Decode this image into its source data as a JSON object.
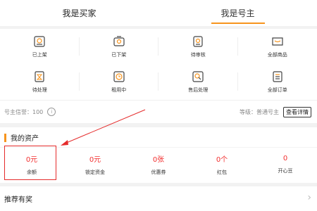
{
  "tabs": [
    {
      "label": "我是买家",
      "active": false
    },
    {
      "label": "我是号主",
      "active": true
    }
  ],
  "menu": [
    {
      "label": "已上架",
      "icon": "shelf-up-icon"
    },
    {
      "label": "已下架",
      "icon": "shelf-down-icon"
    },
    {
      "label": "待审核",
      "icon": "pending-review-icon"
    },
    {
      "label": "全部商品",
      "icon": "all-products-icon"
    },
    {
      "label": "待处理",
      "icon": "pending-icon"
    },
    {
      "label": "租用中",
      "icon": "renting-icon"
    },
    {
      "label": "售后处理",
      "icon": "after-sales-icon"
    },
    {
      "label": "全部订单",
      "icon": "all-orders-icon"
    }
  ],
  "credit": {
    "label": "号主信誉：100",
    "level": "等级：普通号主",
    "detail_button": "查看详情"
  },
  "assets": {
    "title": "我的资产",
    "items": [
      {
        "value": "0元",
        "label": "余额"
      },
      {
        "value": "0元",
        "label": "锁定资金"
      },
      {
        "value": "0张",
        "label": "优惠券"
      },
      {
        "value": "0个",
        "label": "红包"
      },
      {
        "value": "0",
        "label": "开心豆"
      }
    ]
  },
  "recommend": {
    "title": "推荐有奖"
  },
  "colors": {
    "accent": "#f7941d",
    "value_red": "#f23030",
    "annotation_red": "#e52b2b"
  }
}
